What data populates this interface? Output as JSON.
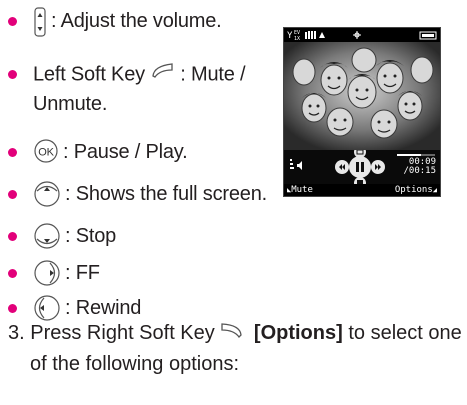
{
  "bullets": [
    {
      "icon": "volume-key-icon",
      "text": ": Adjust the volume."
    },
    {
      "icon": "left-soft-key-icon",
      "text_before": "Left Soft Key",
      "text": ": Mute /",
      "text2": "Unmute."
    },
    {
      "icon": "ok-key-icon",
      "text": ": Pause / Play."
    },
    {
      "icon": "up-nav-key-icon",
      "text": ": Shows the full screen."
    },
    {
      "icon": "down-nav-key-icon",
      "text": ": Stop"
    },
    {
      "icon": "right-nav-key-icon",
      "text": ": FF"
    },
    {
      "icon": "left-nav-key-icon",
      "text": ": Rewind"
    }
  ],
  "ok_label": "OK",
  "step": {
    "number": "3.",
    "text_before": "Press Right Soft Key",
    "bold": "[Options]",
    "text_after": "to select one",
    "line2": "of the following options:"
  },
  "phone_screen": {
    "elapsed": "00:09",
    "total": "/00:15",
    "soft_left": "Mute",
    "soft_right": "Options",
    "status_left": "T ",
    "status_ev": "EV 1X"
  },
  "colors": {
    "bullet": "#e2007a",
    "text": "#231f20"
  }
}
